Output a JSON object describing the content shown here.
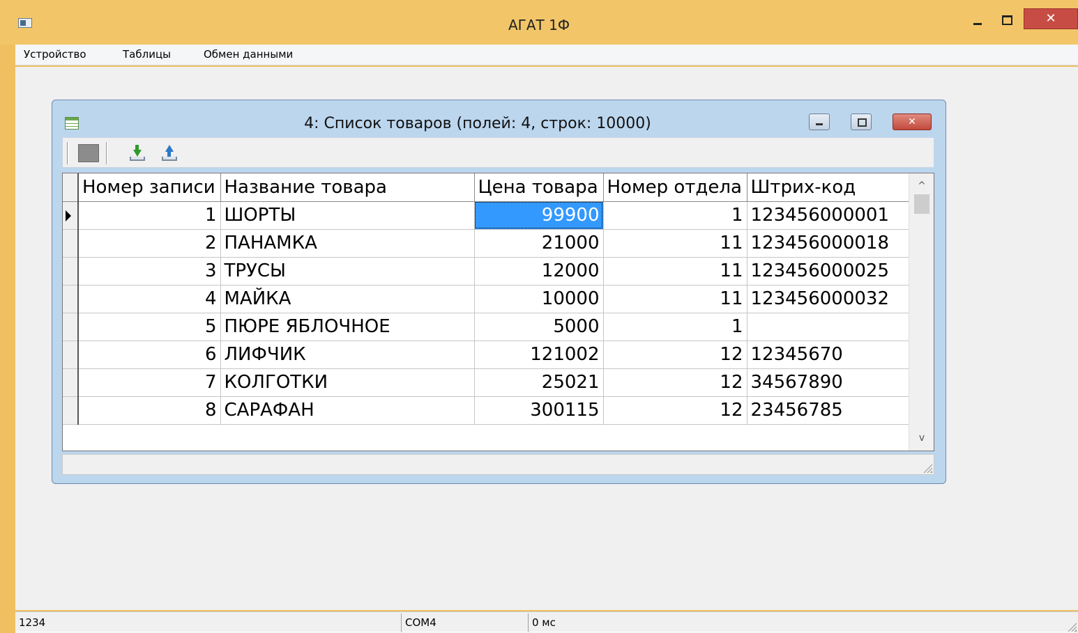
{
  "window": {
    "title": "АГАТ 1Ф",
    "close_glyph": "✕"
  },
  "menu": {
    "items": [
      "Устройство",
      "Таблицы",
      "Обмен данными"
    ]
  },
  "child": {
    "title": "4: Список товаров (полей: 4, строк: 10000)",
    "close_glyph": "✕"
  },
  "table": {
    "columns": [
      "Номер записи",
      "Название товара",
      "Цена товара",
      "Номер отдела",
      "Штрих-код"
    ],
    "rows": [
      [
        "1",
        "ШОРТЫ",
        "99900",
        "1",
        "123456000001"
      ],
      [
        "2",
        "ПАНАМКА",
        "21000",
        "11",
        "123456000018"
      ],
      [
        "3",
        "ТРУСЫ",
        "12000",
        "11",
        "123456000025"
      ],
      [
        "4",
        "МАЙКА",
        "10000",
        "11",
        "123456000032"
      ],
      [
        "5",
        "ПЮРЕ ЯБЛОЧНОЕ",
        "5000",
        "1",
        ""
      ],
      [
        "6",
        "ЛИФЧИК",
        "121002",
        "12",
        "12345670"
      ],
      [
        "7",
        "КОЛГОТКИ",
        "25021",
        "12",
        "34567890"
      ],
      [
        "8",
        "САРАФАН",
        "300115",
        "12",
        "23456785"
      ]
    ]
  },
  "scroll": {
    "up": "^",
    "down": "v"
  },
  "status": {
    "panel1": "1234",
    "panel2": "COM4",
    "panel3": "0 мс"
  },
  "colors": {
    "titlebar": "#f2c668",
    "selection": "#3399ff",
    "child_frame": "#bcd6ee"
  }
}
